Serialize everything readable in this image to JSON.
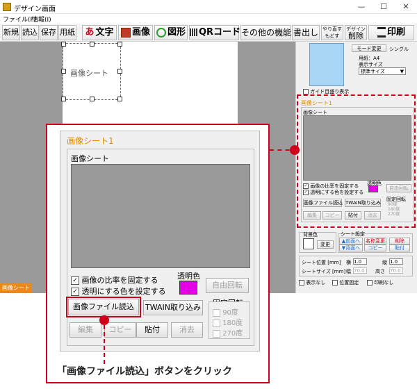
{
  "window": {
    "title": "デザイン画面",
    "min": "—",
    "max": "☐",
    "close": "✕"
  },
  "menu": {
    "file": "ファイル(F)",
    "info": "情報(I)"
  },
  "toolbar": {
    "new": "新規",
    "open": "読込",
    "save": "保存",
    "paper": "用紙",
    "text": "文字",
    "text_glyph": "あ",
    "image": "画像",
    "shape": "図形",
    "qr": "QRコード",
    "other": "その他の機能",
    "export": "書出し",
    "redo_top": "やり直す",
    "redo_bottom": "もどす",
    "delete_top": "デザイン",
    "delete_bottom": "削除",
    "print": "印刷"
  },
  "canvas": {
    "sheet_label": "画像シート"
  },
  "status": {
    "label": "画像シート1"
  },
  "side": {
    "mode_button": "モード変更",
    "mode_value": "シングル",
    "paper": "用紙：A4",
    "display_size": "表示サイズ",
    "display_value": "標準サイズ",
    "stop_display": "ガイド目盛り表示",
    "panel_title": "画像シート1",
    "image_group": "画像シート",
    "fix_ratio": "画像の比率を固定する",
    "set_transparent": "透明にする色を設定する",
    "transparent_color": "透明色",
    "free_rotate": "自由回転",
    "read_file": "画像ファイル読込",
    "twain": "TWAIN取り込み",
    "fixed_rotate": "固定回転",
    "deg90": "90度",
    "deg180": "180度",
    "deg270": "270度",
    "edit": "編集",
    "copy": "コピー",
    "paste": "貼付",
    "erase": "消去",
    "bg_color": "背景色",
    "change": "変更",
    "sheet_settings": "シート設定",
    "front": "▲前面へ",
    "back": "▼背面へ",
    "rename": "名称変更",
    "copy2": "コピー",
    "remove": "削除",
    "paste2": "貼付",
    "pos_label": "シート位置 [mm]",
    "pos_x": "横",
    "pos_x_val": "1.0",
    "pos_y": "縦",
    "pos_y_val": "1.0",
    "size_label": "シートサイズ [mm]",
    "width": "幅",
    "width_val": "70.0",
    "height": "高さ",
    "height_val": "70.0",
    "hide": "表示なし",
    "lock": "位置固定",
    "noprint": "印刷なし"
  },
  "callout": {
    "caption": "「画像ファイル読込」ボタンをクリック"
  },
  "colors": {
    "transparent": "#e600e6",
    "preview": "#a8d4f5",
    "accent": "#d0021b",
    "title_orange": "#e08a00"
  }
}
